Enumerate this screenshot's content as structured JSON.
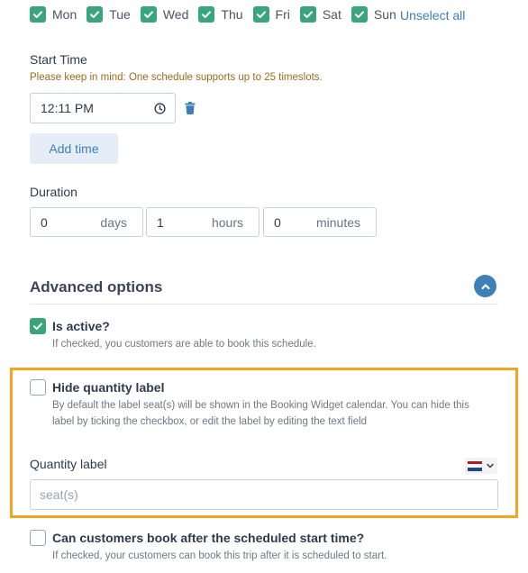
{
  "days": [
    {
      "label": "Mon",
      "checked": true
    },
    {
      "label": "Tue",
      "checked": true
    },
    {
      "label": "Wed",
      "checked": true
    },
    {
      "label": "Thu",
      "checked": true
    },
    {
      "label": "Fri",
      "checked": true
    },
    {
      "label": "Sat",
      "checked": true
    },
    {
      "label": "Sun",
      "checked": true
    }
  ],
  "unselect_all": "Unselect all",
  "start_time": {
    "label": "Start Time",
    "hint": "Please keep in mind: One schedule supports up to 25 timeslots.",
    "value": "12:11 PM",
    "add_time": "Add time"
  },
  "duration": {
    "label": "Duration",
    "days": {
      "value": "0",
      "unit": "days"
    },
    "hours": {
      "value": "1",
      "unit": "hours"
    },
    "minutes": {
      "value": "0",
      "unit": "minutes"
    }
  },
  "advanced": {
    "title": "Advanced options",
    "is_active": {
      "label": "Is active?",
      "checked": true,
      "description": "If checked, you customers are able to book this schedule."
    },
    "hide_quantity": {
      "label": "Hide quantity label",
      "checked": false,
      "description_line1": "By default the label seat(s) will be shown in the Booking Widget calendar. You can hide this",
      "description_line2": "label by ticking the checkbox, or edit the label by editing the text field"
    },
    "quantity_label": {
      "label": "Quantity label",
      "placeholder": "seat(s)"
    },
    "book_after_start": {
      "label": "Can customers book after the scheduled start time?",
      "checked": false,
      "description": "If checked, your customers can book this trip after it is scheduled to start."
    }
  },
  "colors": {
    "checkbox_green": "#3aa57d",
    "link_blue": "#3f7fb8",
    "highlight_orange": "#f4a41e"
  }
}
